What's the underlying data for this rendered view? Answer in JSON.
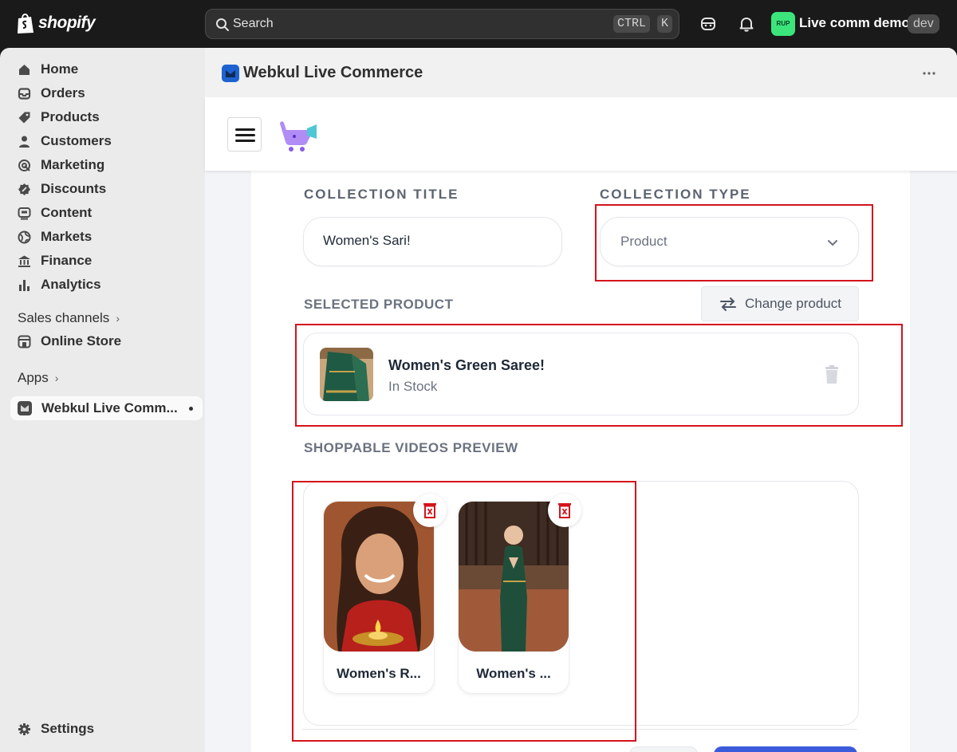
{
  "topbar": {
    "brand": "shopify",
    "search_placeholder": "Search",
    "shortcut_ctrl": "CTRL",
    "shortcut_k": "K",
    "store_badge": "RUP",
    "store_name": "Live comm demo",
    "env_badge": "dev"
  },
  "sidebar": {
    "items": [
      {
        "label": "Home",
        "icon": "home-icon"
      },
      {
        "label": "Orders",
        "icon": "inbox-icon"
      },
      {
        "label": "Products",
        "icon": "tag-icon"
      },
      {
        "label": "Customers",
        "icon": "person-icon"
      },
      {
        "label": "Marketing",
        "icon": "target-icon"
      },
      {
        "label": "Discounts",
        "icon": "discount-icon"
      },
      {
        "label": "Content",
        "icon": "content-icon"
      },
      {
        "label": "Markets",
        "icon": "globe-icon"
      },
      {
        "label": "Finance",
        "icon": "bank-icon"
      },
      {
        "label": "Analytics",
        "icon": "bar-chart-icon"
      }
    ],
    "sales_channels_label": "Sales channels",
    "online_store_label": "Online Store",
    "apps_label": "Apps",
    "active_app_label": "Webkul Live Comm...",
    "settings_label": "Settings"
  },
  "app": {
    "title": "Webkul Live Commerce"
  },
  "form": {
    "collection_title_label": "COLLECTION TITLE",
    "collection_title_value": "Women's Sari!",
    "collection_type_label": "COLLECTION TYPE",
    "collection_type_value": "Product",
    "selected_product_label": "SELECTED PRODUCT",
    "change_product_label": "Change product",
    "product": {
      "name": "Women's Green Saree!",
      "stock": "In Stock"
    },
    "videos_label": "SHOPPABLE VIDEOS PREVIEW",
    "videos": [
      {
        "title": "Women's R..."
      },
      {
        "title": "Women's ..."
      }
    ]
  },
  "colors": {
    "annotation_red": "#d4141c",
    "store_badge_green": "#3ce57c",
    "primary_blue": "#3b5bdb"
  }
}
